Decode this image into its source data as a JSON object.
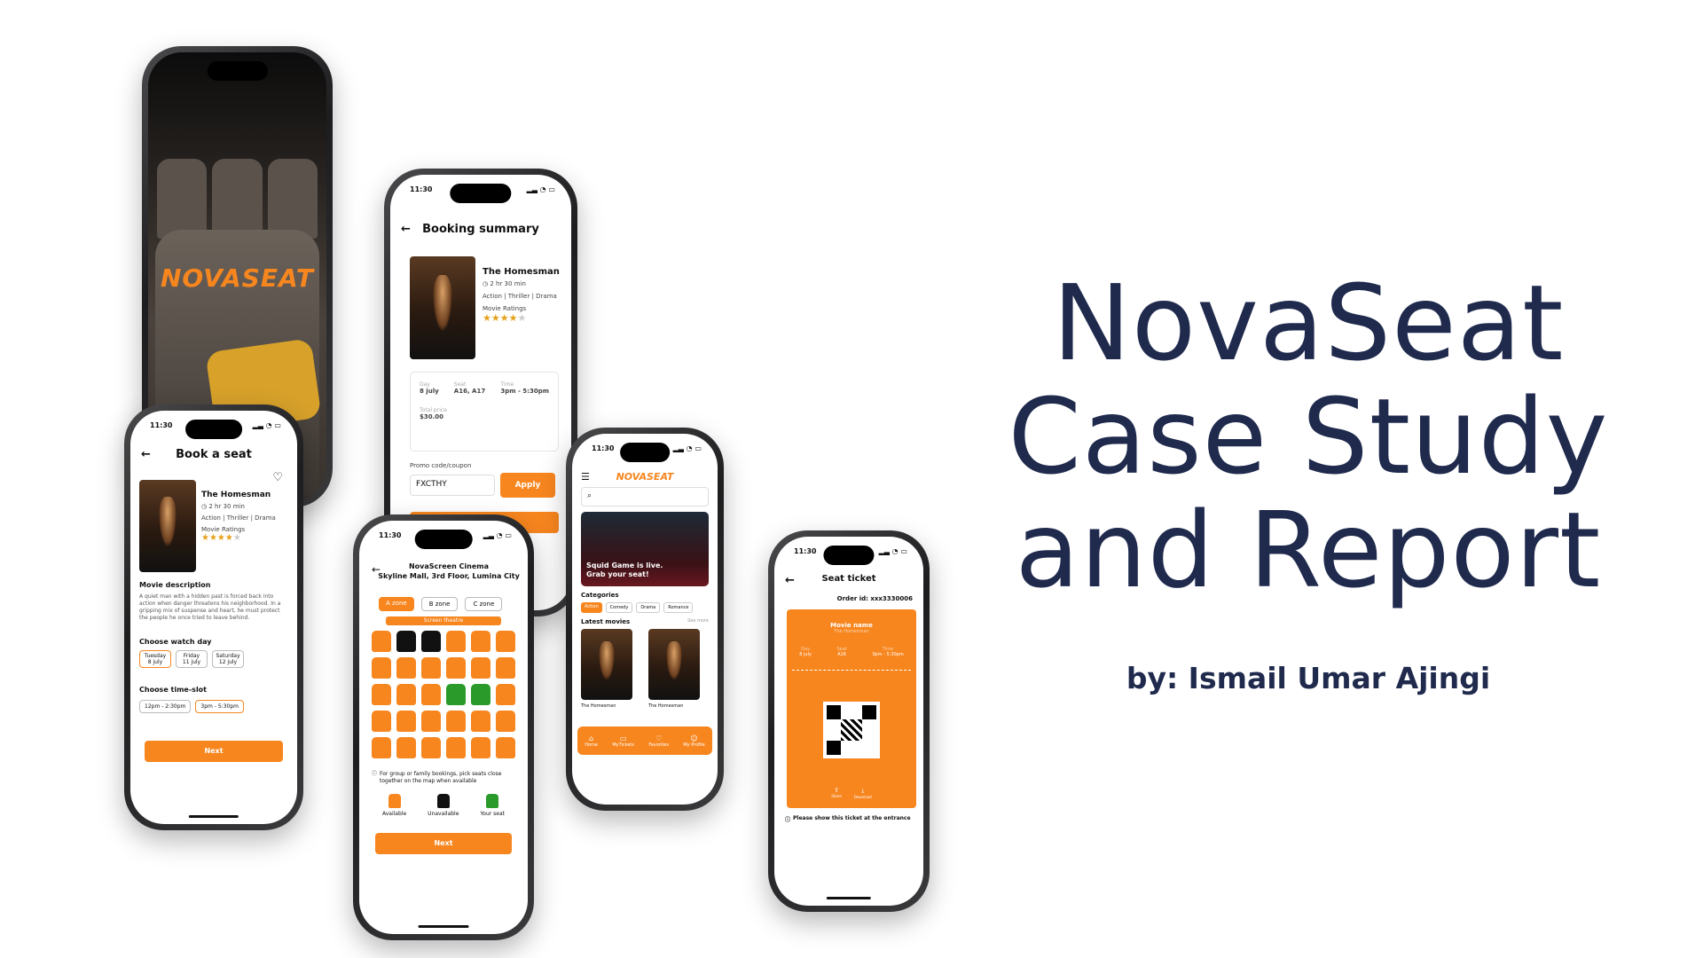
{
  "brand": {
    "accent": "#f7861f",
    "title_color": "#1f2a4d"
  },
  "title": {
    "line1": "NovaSeat",
    "line2": "Case Study",
    "line3": "and Report"
  },
  "byline": "by: Ismail Umar Ajingi",
  "splash": {
    "logo": "NOVASEAT"
  },
  "common": {
    "time": "11:30"
  },
  "booking_summary": {
    "header": "Booking summary",
    "movie": "The Homesman",
    "duration": "2 hr 30 min",
    "genres": "Action | Thriller | Drama",
    "ratings_label": "Movie Ratings",
    "stars": "★★★★",
    "star_empty": "★",
    "day_label": "Day",
    "day": "8 july",
    "seat_label": "Seat",
    "seat": "A16, A17",
    "time_label": "Time",
    "time": "3pm - 5:30pm",
    "price_label": "Total price",
    "price": "$30.00",
    "promo_label": "Promo code/coupon",
    "promo_value": "FXCTHY",
    "apply": "Apply"
  },
  "book_seat": {
    "header": "Book a seat",
    "movie": "The Homesman",
    "duration": "2 hr 30 min",
    "genres": "Action | Thriller | Drama",
    "ratings_label": "Movie Ratings",
    "stars": "★★★★",
    "star_empty": "★",
    "desc_title": "Movie description",
    "desc": "A quiet man with a hidden past is forced back into action when danger threatens his neighborhood. In a gripping mix of suspense and heart, he must protect the people he once tried to leave behind.",
    "watch_day_title": "Choose watch day",
    "days": [
      {
        "d": "Tuesday",
        "n": "8 july"
      },
      {
        "d": "Friday",
        "n": "11 july"
      },
      {
        "d": "Saturday",
        "n": "12 july"
      }
    ],
    "slot_title": "Choose time-slot",
    "slots": [
      "12pm - 2:30pm",
      "3pm - 5:30pm"
    ],
    "next": "Next"
  },
  "seat_map": {
    "cinema": "NovaScreen Cinema",
    "address": "Skyline Mall, 3rd Floor, Lumina City",
    "zones": [
      "A zone",
      "B zone",
      "C zone"
    ],
    "screen": "Screen theatre",
    "note": "For group or family bookings, pick seats close together on the map when available",
    "legend": [
      "Available",
      "Unavailable",
      "Your seat"
    ],
    "next": "Next"
  },
  "home": {
    "logo": "NOVASEAT",
    "banner_l1": "Squid Game is live.",
    "banner_l2": "Grab your seat!",
    "categories_title": "Categories",
    "categories": [
      "Action",
      "Comedy",
      "Drama",
      "Romance"
    ],
    "latest": "Latest movies",
    "see_more": "See more",
    "movies": [
      "The Homesman",
      "The Homesman"
    ],
    "tabs": [
      "Home",
      "MyTickets",
      "Favorites",
      "My Profile"
    ]
  },
  "ticket": {
    "header": "Seat ticket",
    "order": "Order id: xxx3330006",
    "movie_label": "Movie name",
    "movie": "The Homesman",
    "day_label": "Day",
    "day": "8 july",
    "seat_label": "Seat",
    "seat": "A16",
    "time_label": "Time",
    "time": "3pm - 5:30pm",
    "share": "Share",
    "download": "Download",
    "note": "Please show this ticket at the entrance"
  }
}
